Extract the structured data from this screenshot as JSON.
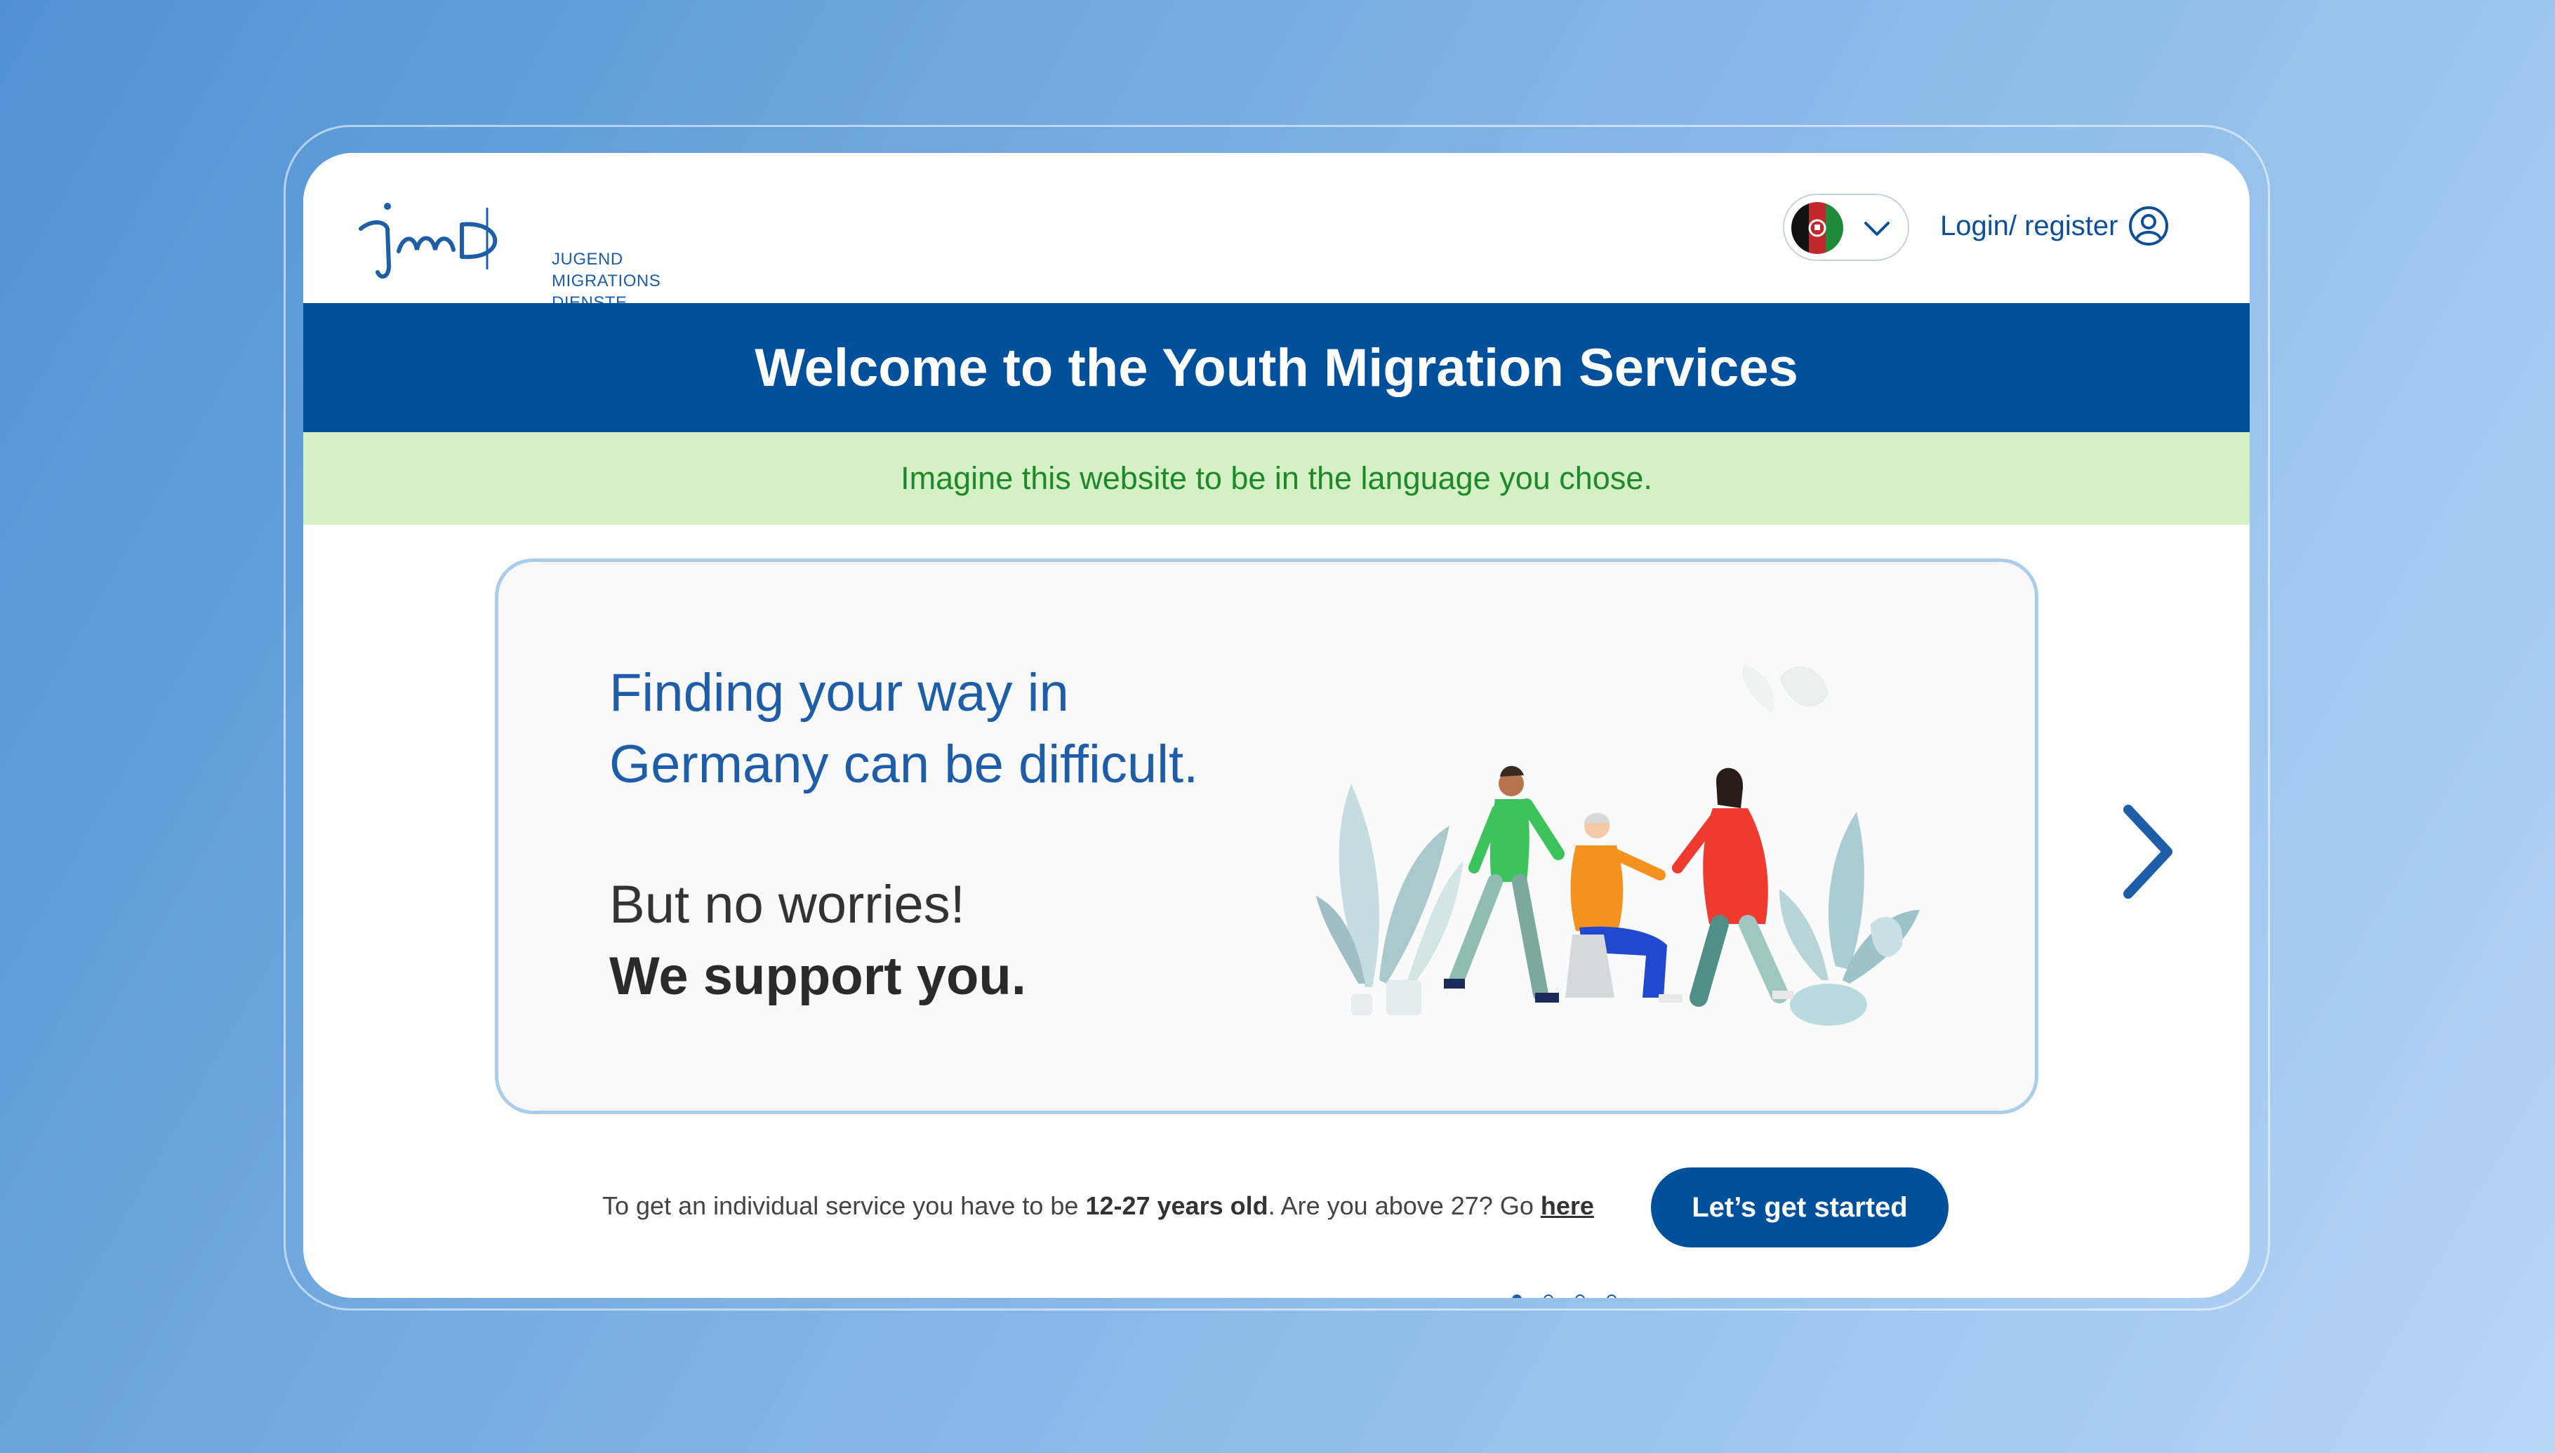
{
  "logo": {
    "wordmark": "jmD",
    "lines": [
      "JUGEND",
      "MIGRATIONS",
      "DIENSTE"
    ]
  },
  "header": {
    "language_flag": "afghanistan-flag-icon",
    "login_label": "Login/ register"
  },
  "banner": {
    "title": "Welcome to the Youth Migration Services"
  },
  "notice": {
    "text": "Imagine this website to be in the language you chose."
  },
  "carousel": {
    "headline_line1": "Finding your way in",
    "headline_line2": "Germany can be difficult.",
    "sub_line1": "But no worries!",
    "sub_line2": "We support you.",
    "slide_count": 4,
    "active_slide": 1
  },
  "footer": {
    "text_before": "To get an individual service you have to be ",
    "age_range": "12-27 years old",
    "text_after": ". Are you above 27? Go ",
    "link": "here",
    "cta_label": "Let’s get started"
  },
  "colors": {
    "primary": "#00509c",
    "notice_bg": "#d6f0c5",
    "notice_text": "#1d8a2a",
    "card_border": "#a9cdea"
  }
}
